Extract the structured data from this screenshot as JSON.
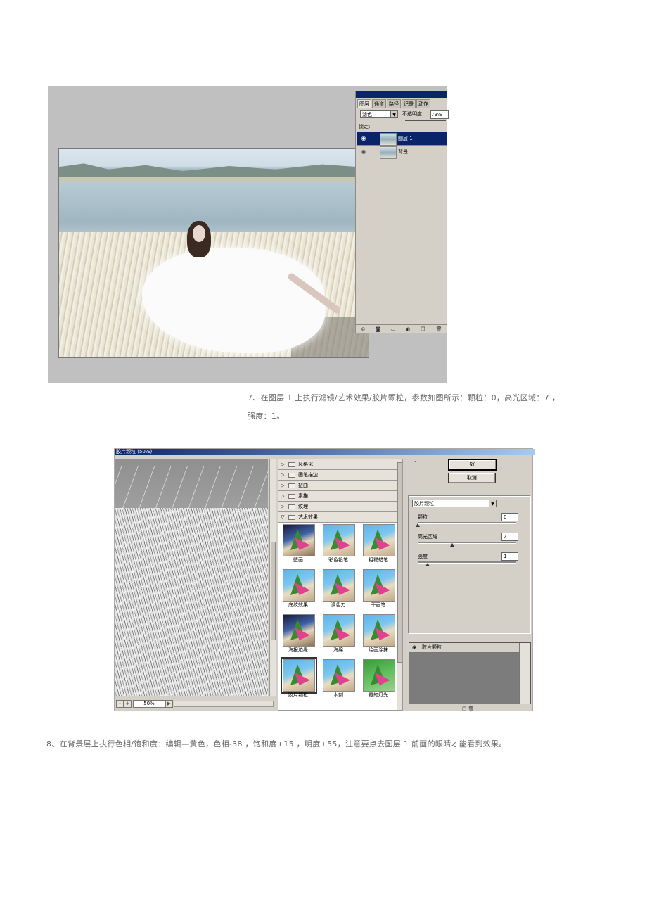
{
  "layers_panel": {
    "tabs": [
      "图层",
      "通道",
      "路径",
      "记录",
      "动作"
    ],
    "blend_mode": "滤色",
    "opacity_label": "不透明度:",
    "opacity_value": "79%",
    "lock_label": "锁定:",
    "layers": [
      {
        "name": "图层 1",
        "selected": true
      },
      {
        "name": "背景",
        "selected": false
      }
    ]
  },
  "step7_caption": {
    "line1": "7、在图层 1 上执行滤镜/艺术效果/胶片颗粒，参数如图所示：颗粒：0，高光区域：7 ，",
    "line2": "强度：1。"
  },
  "filter_dialog": {
    "title": "胶片颗粒 (50%)",
    "zoom": "50%",
    "categories": [
      {
        "name": "风格化",
        "expanded": false
      },
      {
        "name": "画笔描边",
        "expanded": false
      },
      {
        "name": "扭曲",
        "expanded": false
      },
      {
        "name": "素描",
        "expanded": false
      },
      {
        "name": "纹理",
        "expanded": false
      },
      {
        "name": "艺术效果",
        "expanded": true
      }
    ],
    "thumbnails": [
      "壁画",
      "彩色铅笔",
      "粗糙蜡笔",
      "底纹效果",
      "调色刀",
      "干画笔",
      "海报边缘",
      "海绵",
      "绘画涂抹",
      "胶片颗粒",
      "木刻",
      "霓虹灯光"
    ],
    "selected_thumbnail": "胶片颗粒",
    "ok_label": "好",
    "cancel_label": "取消",
    "filter_select": "胶片颗粒",
    "params": [
      {
        "label": "颗粒",
        "value": "0",
        "fraction": 0.0
      },
      {
        "label": "高光区域",
        "value": "7",
        "fraction": 0.35
      },
      {
        "label": "强度",
        "value": "1",
        "fraction": 0.1
      }
    ],
    "effect_layer": "胶片颗粒"
  },
  "step8_caption": "8、在背景层上执行色相/饱和度：编辑—黄色，色相-38 ，饱和度+15 ，明度+55，注意要点去图层 1 前面的眼睛才能看到效果。",
  "colors": {
    "titlebar": "#0a246a",
    "panel_bg": "#d4d0c8",
    "frame_gray": "#c0c0c0"
  }
}
